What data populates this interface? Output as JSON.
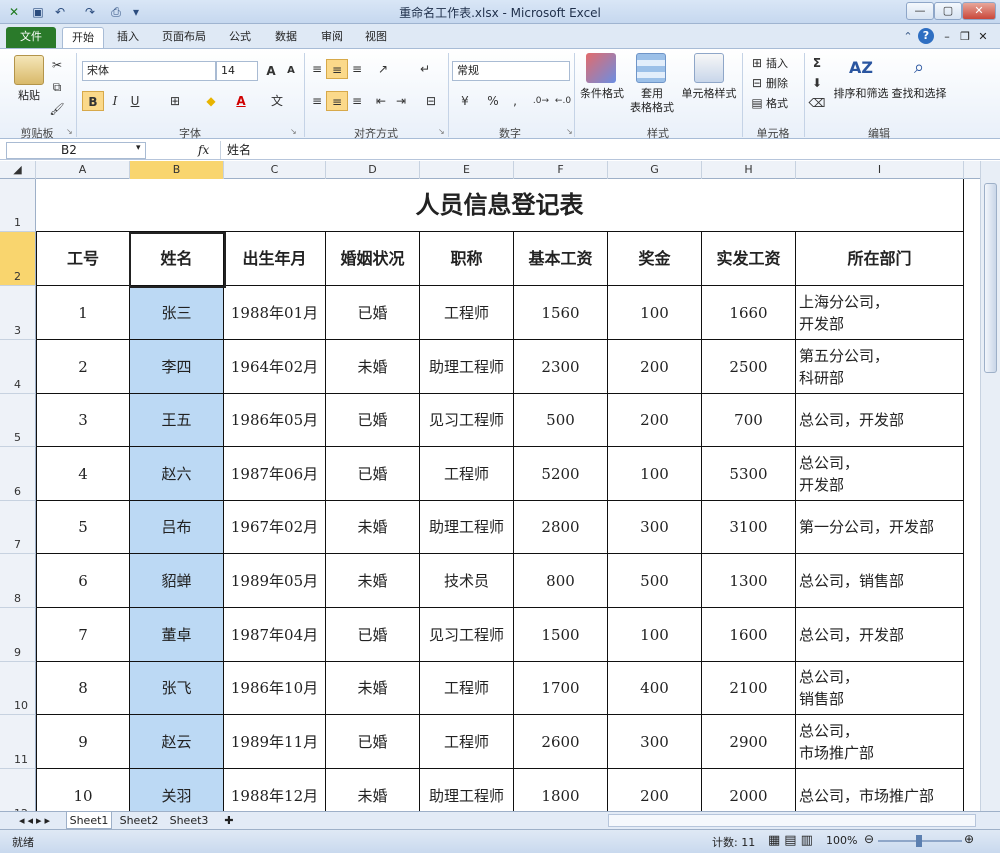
{
  "window": {
    "title": "重命名工作表.xlsx - Microsoft Excel"
  },
  "tabs": [
    "文件",
    "开始",
    "插入",
    "页面布局",
    "公式",
    "数据",
    "审阅",
    "视图"
  ],
  "ribbon": {
    "clipboard": {
      "paste": "粘贴",
      "label": "剪贴板"
    },
    "font": {
      "name": "宋体",
      "size": "14",
      "label": "字体"
    },
    "alignment": {
      "label": "对齐方式"
    },
    "number": {
      "format": "常规",
      "label": "数字"
    },
    "styles": {
      "conditional": "条件格式",
      "table_line1": "套用",
      "table_line2": "表格格式",
      "cell_styles": "单元格样式",
      "label": "样式"
    },
    "cells": {
      "insert": "插入",
      "delete": "删除",
      "format": "格式",
      "label": "单元格"
    },
    "editing": {
      "sort": "排序和筛选",
      "find": "查找和选择",
      "label": "编辑"
    }
  },
  "formula_bar": {
    "name_box": "B2",
    "fx": "fx",
    "value": "姓名"
  },
  "columns": [
    "A",
    "B",
    "C",
    "D",
    "E",
    "F",
    "G",
    "H",
    "I"
  ],
  "sheet": {
    "title": "人员信息登记表",
    "headers": [
      "工号",
      "姓名",
      "出生年月",
      "婚姻状况",
      "职称",
      "基本工资",
      "奖金",
      "实发工资",
      "所在部门"
    ],
    "rows": [
      [
        "1",
        "张三",
        "1988年01月",
        "已婚",
        "工程师",
        "1560",
        "100",
        "1660",
        "上海分公司，\n开发部"
      ],
      [
        "2",
        "李四",
        "1964年02月",
        "未婚",
        "助理工程师",
        "2300",
        "200",
        "2500",
        "第五分公司，\n科研部"
      ],
      [
        "3",
        "王五",
        "1986年05月",
        "已婚",
        "见习工程师",
        "500",
        "200",
        "700",
        "总公司，开发部"
      ],
      [
        "4",
        "赵六",
        "1987年06月",
        "已婚",
        "工程师",
        "5200",
        "100",
        "5300",
        "总公司，\n开发部"
      ],
      [
        "5",
        "吕布",
        "1967年02月",
        "未婚",
        "助理工程师",
        "2800",
        "300",
        "3100",
        "第一分公司，开发部"
      ],
      [
        "6",
        "貂蝉",
        "1989年05月",
        "未婚",
        "技术员",
        "800",
        "500",
        "1300",
        "总公司，销售部"
      ],
      [
        "7",
        "董卓",
        "1987年04月",
        "已婚",
        "见习工程师",
        "1500",
        "100",
        "1600",
        "总公司，开发部"
      ],
      [
        "8",
        "张飞",
        "1986年10月",
        "未婚",
        "工程师",
        "1700",
        "400",
        "2100",
        "总公司，\n销售部"
      ],
      [
        "9",
        "赵云",
        "1989年11月",
        "已婚",
        "工程师",
        "2600",
        "300",
        "2900",
        "总公司，\n市场推广部"
      ],
      [
        "10",
        "关羽",
        "1988年12月",
        "未婚",
        "助理工程师",
        "1800",
        "200",
        "2000",
        "总公司，市场推广部"
      ]
    ]
  },
  "sheet_tabs": [
    "Sheet1",
    "Sheet2",
    "Sheet3"
  ],
  "status": {
    "ready": "就绪",
    "count": "计数: 11",
    "zoom": "100%"
  },
  "colors": {
    "selected_fill": "#bcd9f4",
    "file_tab": "#2a7a2a",
    "row_header_highlight": "#f9d56e"
  }
}
